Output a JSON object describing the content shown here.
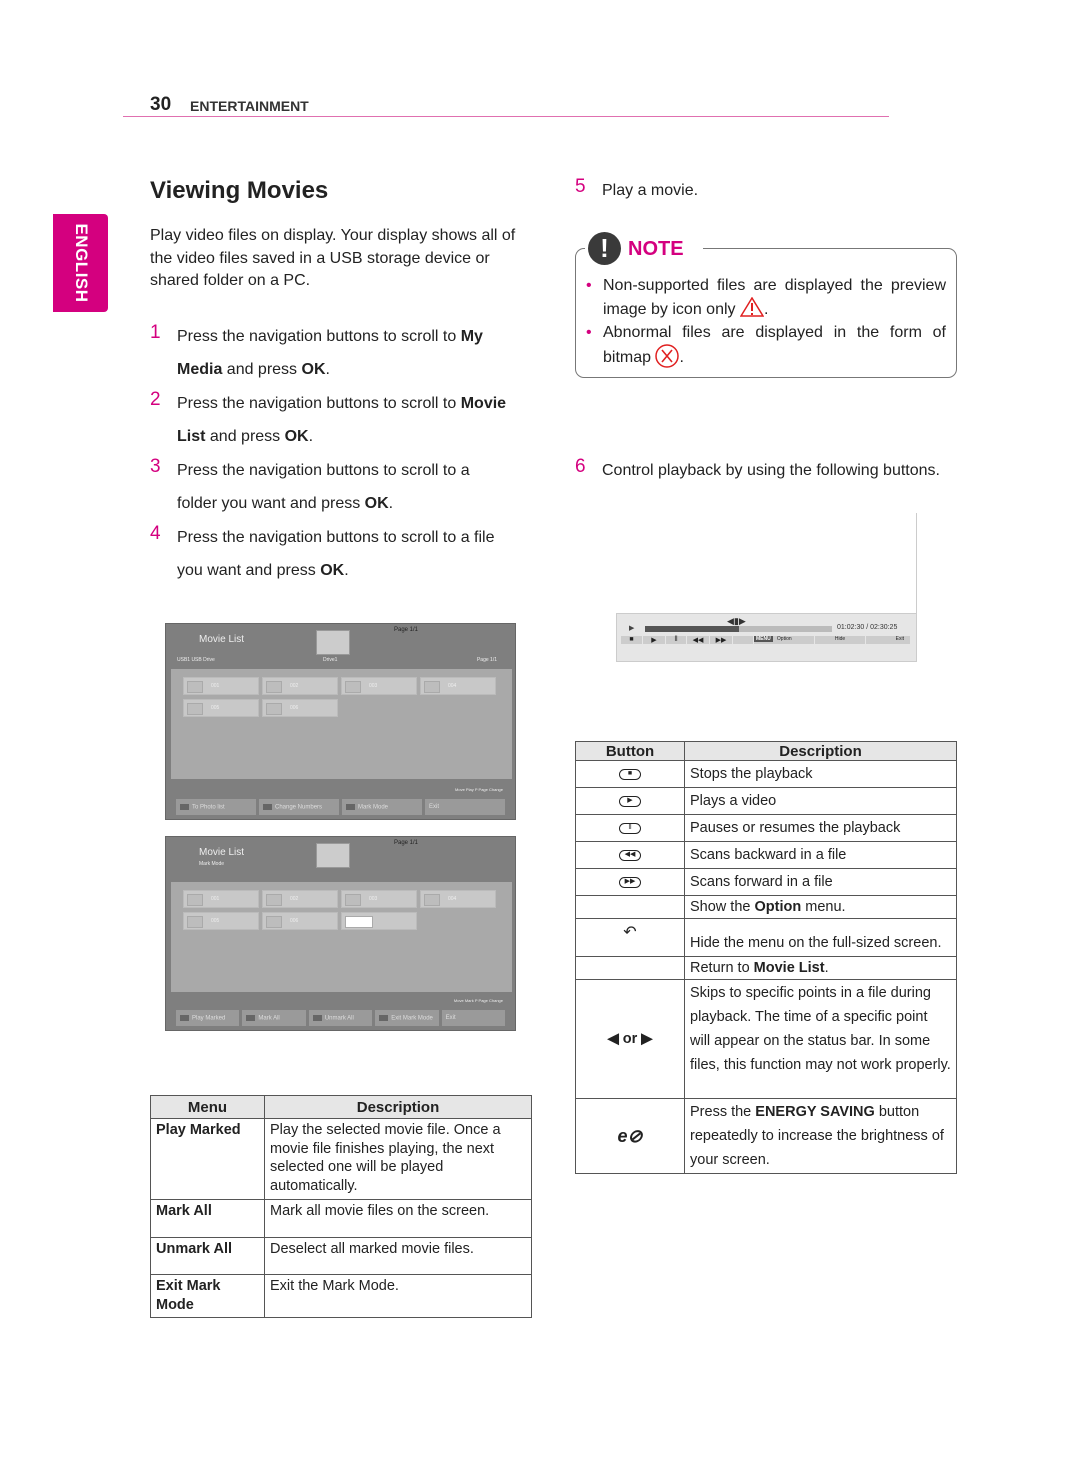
{
  "header": {
    "page_number": "30",
    "section": "ENTERTAINMENT"
  },
  "side_tab": "ENGLISH",
  "title": "Viewing Movies",
  "intro": "Play video files on display. Your display shows all of the video files saved in a USB storage device or shared folder on a PC.",
  "steps": [
    {
      "n": "1",
      "a": "Press the navigation buttons to scroll to ",
      "b": "My",
      "c": "",
      "d": "Media",
      "e": " and press ",
      "f": "OK",
      "g": "."
    },
    {
      "n": "2",
      "a": "Press the navigation buttons to scroll to ",
      "b": "Movie",
      "c": "",
      "d": "List",
      "e": " and press ",
      "f": "OK",
      "g": "."
    },
    {
      "n": "3",
      "a": "Press the navigation buttons to scroll to a",
      "b": "",
      "c": "folder you want and press ",
      "d": "",
      "e": "",
      "f": "OK",
      "g": "."
    },
    {
      "n": "4",
      "a": "Press the navigation buttons to scroll to a file",
      "b": "",
      "c": "you want and press ",
      "d": "",
      "e": "",
      "f": "OK",
      "g": "."
    }
  ],
  "screens": [
    {
      "title": "Movie List",
      "subtitle": "",
      "page_top": "Page 1/1",
      "source": "USB1   USB Drive",
      "drive": "Drive1",
      "page": "Page 1/1",
      "items": [
        "001",
        "002",
        "003",
        "004",
        "005",
        "006"
      ],
      "hints": "Move    Play    P Page Change",
      "buttons": [
        "To Photo list",
        "Change Numbers",
        "Mark Mode",
        "Exit"
      ]
    },
    {
      "title": "Movie List",
      "subtitle": "Mark Mode",
      "page_top": "Page 1/1",
      "source": "USB1   USB Drive",
      "drive": "Drive1",
      "page": "Page 1/1",
      "items": [
        "001",
        "002",
        "003",
        "004",
        "005",
        "006"
      ],
      "hints": "Move    Mark    P Page Change",
      "buttons": [
        "Play Marked",
        "Mark All",
        "Unmark All",
        "Exit Mark Mode",
        "Exit"
      ]
    }
  ],
  "menu_table": {
    "headers": [
      "Menu",
      "Description"
    ],
    "rows": [
      {
        "menu": "Play Marked",
        "desc": "Play the selected movie file. Once a movie file finishes playing, the next selected one will be played automatically."
      },
      {
        "menu": "Mark All",
        "desc": "Mark all movie files on the screen."
      },
      {
        "menu": "Unmark All",
        "desc": "Deselect all marked movie files."
      },
      {
        "menu": "Exit Mark Mode",
        "desc": "Exit the Mark Mode."
      }
    ]
  },
  "step5": {
    "n": "5",
    "text": "Play a movie."
  },
  "note": {
    "title": "NOTE",
    "item1a": "Non-supported files are displayed the preview image by icon only",
    "item2a": "Abnormal files are displayed in the form of bitmap",
    "dot": "."
  },
  "step6": {
    "n": "6",
    "text": "Control playback by using the following buttons."
  },
  "player": {
    "time": "01:02:30 / 02:30:25",
    "progress": 0.5,
    "menu": "MENU",
    "option": "Option",
    "hide": "Hide",
    "exit": "Exit"
  },
  "button_table": {
    "headers": [
      "Button",
      "Description"
    ],
    "r1": "Stops the playback",
    "r2": "Plays a video",
    "r3": "Pauses or resumes the playback",
    "r4": "Scans backward in a file",
    "r5": "Scans forward in a file",
    "r6a": "Show the ",
    "r6b": "Option",
    "r6c": " menu.",
    "r7": "Hide the menu on the full-sized screen.",
    "r8a": "Return to ",
    "r8b": "Movie List",
    "r8c": ".",
    "r9icon": "◀ or ▶",
    "r9": "Skips to specific points in a file during playback. The time of a specific point will appear on the status bar. In some files, this function may not work properly.",
    "r10a": "Press the ",
    "r10b": "ENERGY SAVING",
    "r10c": " button repeatedly to increase the brightness of your screen."
  },
  "colors": {
    "accent": "#d4007f"
  }
}
